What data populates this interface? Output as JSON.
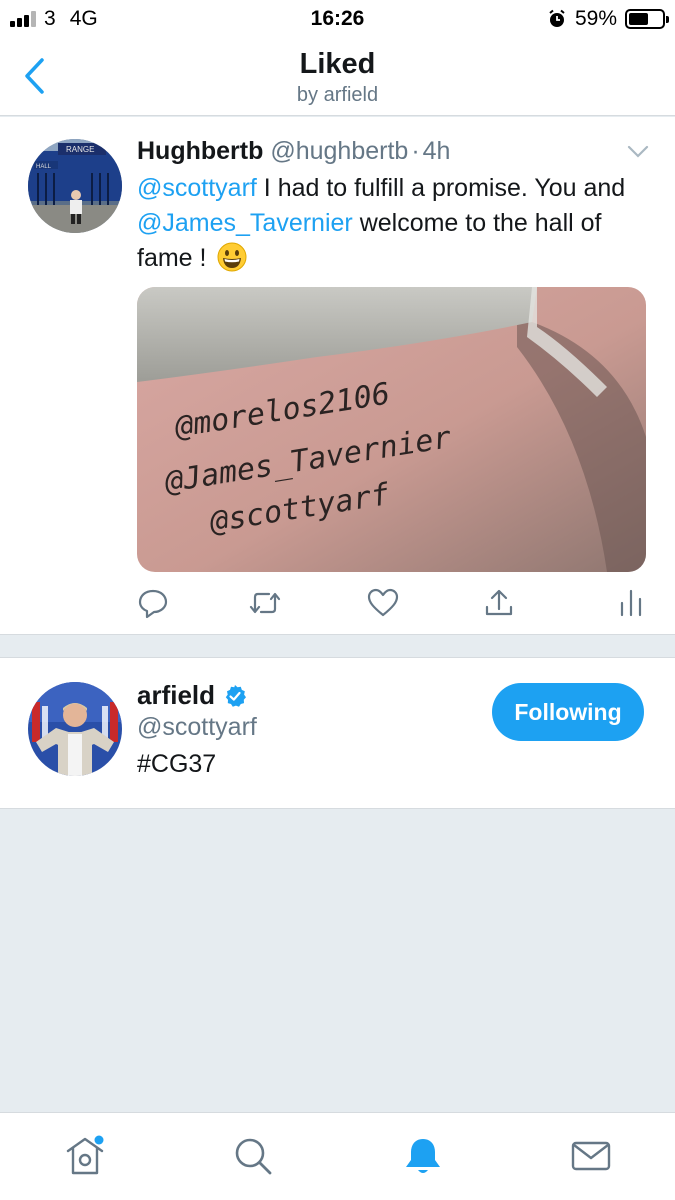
{
  "status_bar": {
    "carrier": "3",
    "network": "4G",
    "time": "16:26",
    "battery": "59%",
    "battery_level": 0.59,
    "icons": [
      "signal-icon",
      "alarm-icon",
      "battery-icon"
    ]
  },
  "header": {
    "title": "Liked",
    "subtitle": "by arfield",
    "back_icon": "chevron-left-icon"
  },
  "tweet": {
    "name": "Hughbertb",
    "handle": "@hughbertb",
    "separator": "·",
    "time": "4h",
    "text": {
      "mention1": "@scottyarf",
      "part1": " I had to fulfill a promise. You and ",
      "mention2": "@James_Tavernier",
      "part2": " welcome to the hall of fame !"
    },
    "emoji": "grinning-face-emoji",
    "media_tattoo_lines": [
      "@morelos2106",
      "@James_Tavernier",
      "@scottyarf"
    ],
    "actions": [
      "reply-icon",
      "retweet-icon",
      "like-icon",
      "share-icon",
      "analytics-icon"
    ]
  },
  "user_card": {
    "name": "arfield",
    "verified": true,
    "handle": "@scottyarf",
    "bio": "#CG37",
    "follow_label": "Following"
  },
  "tab_bar": {
    "items": [
      "home-icon",
      "search-icon",
      "notifications-icon",
      "messages-icon"
    ],
    "active": "notifications-icon",
    "home_has_dot": true
  },
  "colors": {
    "accent": "#1da1f2",
    "text": "#14171a",
    "secondary": "#657786",
    "background": "#e6ecf0"
  }
}
